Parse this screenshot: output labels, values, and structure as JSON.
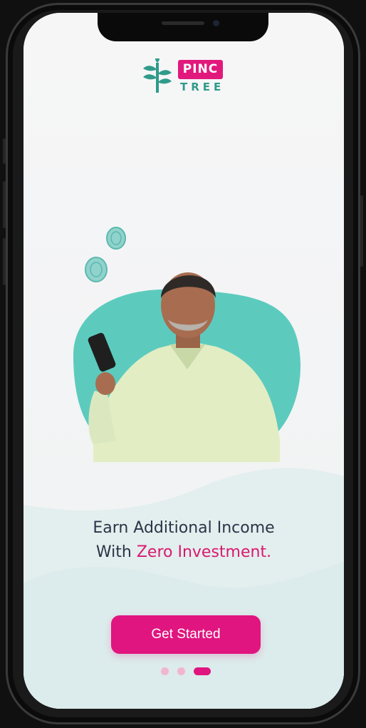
{
  "brand": {
    "badge": "PINC",
    "sub": "TREE",
    "primary_color": "#e0157f",
    "teal_color": "#5ccbbe"
  },
  "onboarding": {
    "headline_line1": "Earn Additional Income",
    "headline_line2_prefix": "With ",
    "headline_line2_accent": "Zero Investment."
  },
  "cta": {
    "label": "Get Started"
  },
  "pager": {
    "count": 3,
    "active_index": 2
  }
}
